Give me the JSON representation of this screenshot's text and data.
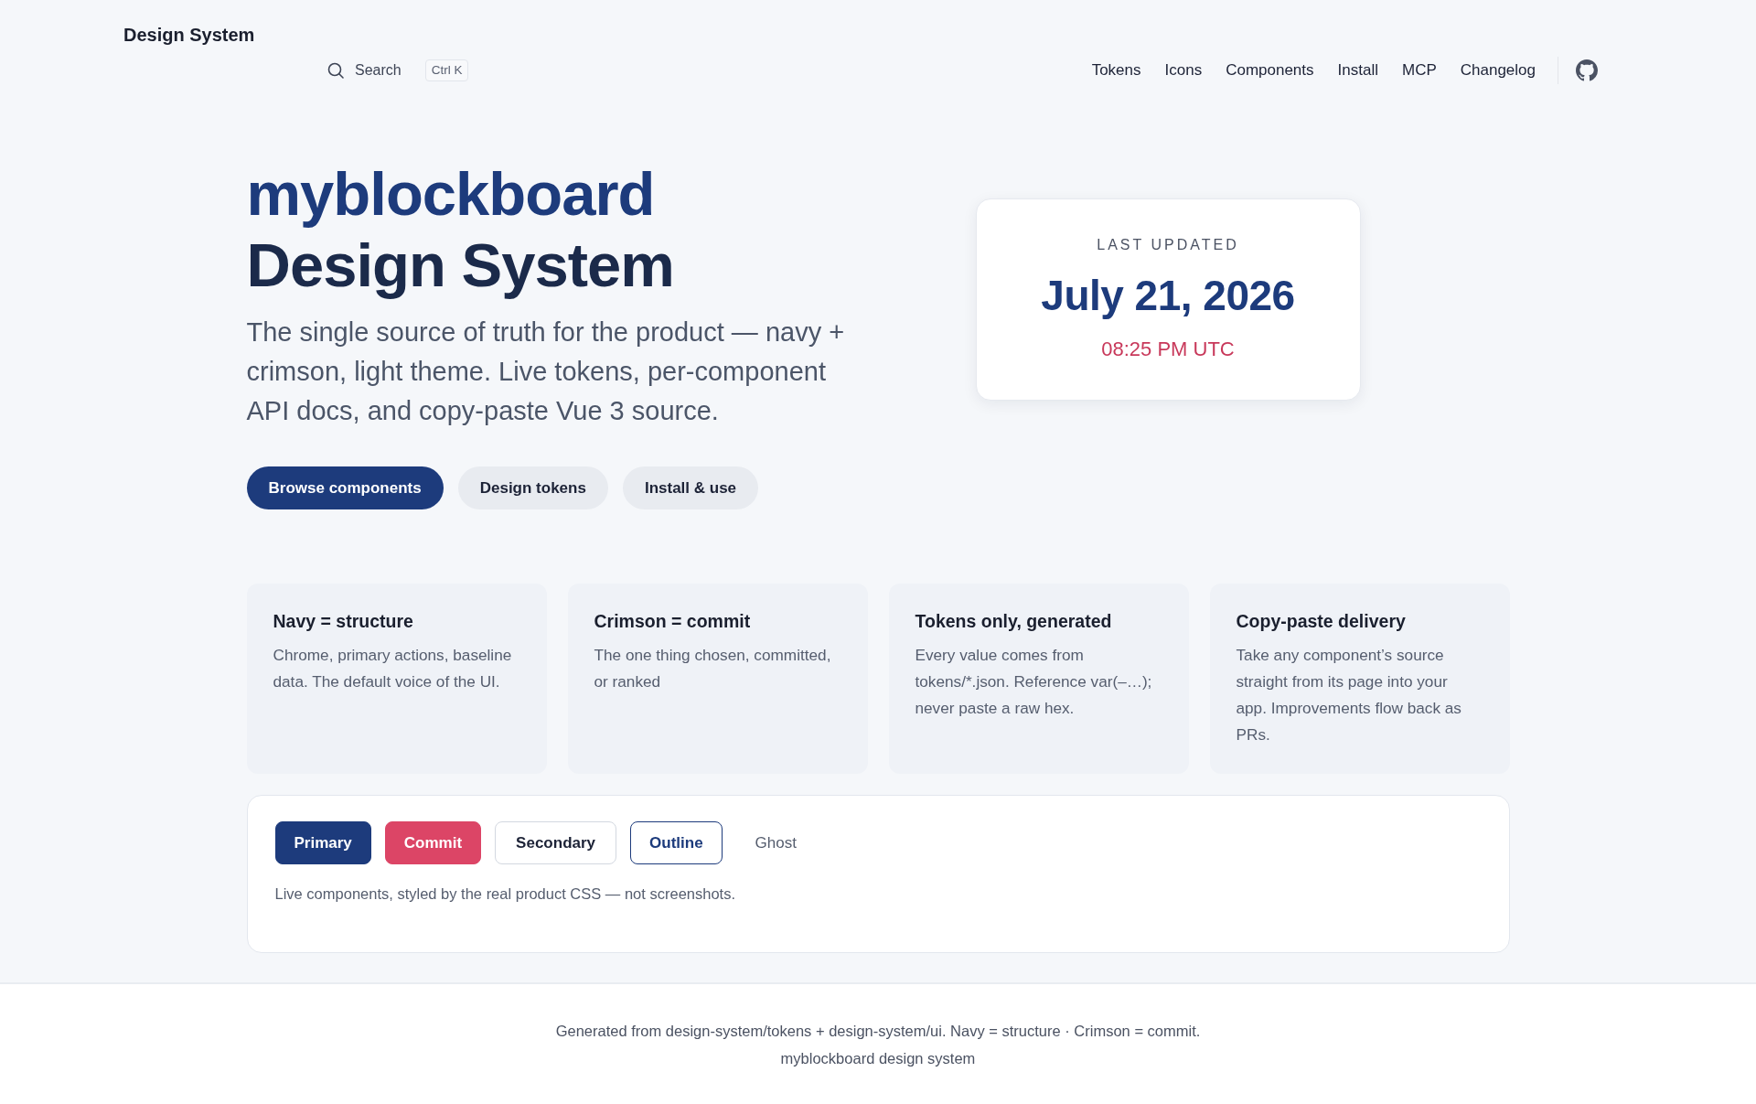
{
  "header": {
    "brand": "Design System",
    "search": {
      "label": "Search",
      "shortcut": "Ctrl K"
    },
    "nav": [
      "Tokens",
      "Icons",
      "Components",
      "Install",
      "MCP",
      "Changelog"
    ]
  },
  "hero": {
    "title_line_1": "myblockboard",
    "title_line_2": "Design System",
    "lead": "The single source of truth for the product — navy + crimson, light theme. Live tokens, per-component API docs, and copy-paste Vue 3 source.",
    "actions": [
      {
        "label": "Browse components",
        "kind": "primary"
      },
      {
        "label": "Design tokens",
        "kind": "soft"
      },
      {
        "label": "Install & use",
        "kind": "soft"
      }
    ]
  },
  "updated_card": {
    "label": "LAST UPDATED",
    "date": "July 21, 2026",
    "time": "08:25 PM UTC"
  },
  "principles": [
    {
      "title": "Navy = structure",
      "text": "Chrome, primary actions, baseline data. The default voice of the UI."
    },
    {
      "title": "Crimson = commit",
      "text": "The one thing chosen, committed, or ranked"
    },
    {
      "title": "Tokens only, generated",
      "text": "Every value comes from tokens/*.json. Reference var(–…); never paste a raw hex."
    },
    {
      "title": "Copy-paste delivery",
      "text": "Take any component’s source straight from its page into your app. Improvements flow back as PRs."
    }
  ],
  "demo": {
    "buttons": [
      {
        "label": "Primary",
        "kind": "primary"
      },
      {
        "label": "Commit",
        "kind": "commit"
      },
      {
        "label": "Secondary",
        "kind": "secondary"
      },
      {
        "label": "Outline",
        "kind": "outline"
      },
      {
        "label": "Ghost",
        "kind": "ghost"
      }
    ],
    "note": "Live components, styled by the real product CSS — not screenshots."
  },
  "footer": {
    "lines": [
      "Generated from design-system/tokens + design-system/ui. Navy = structure · Crimson = commit.",
      "myblockboard design system"
    ]
  }
}
